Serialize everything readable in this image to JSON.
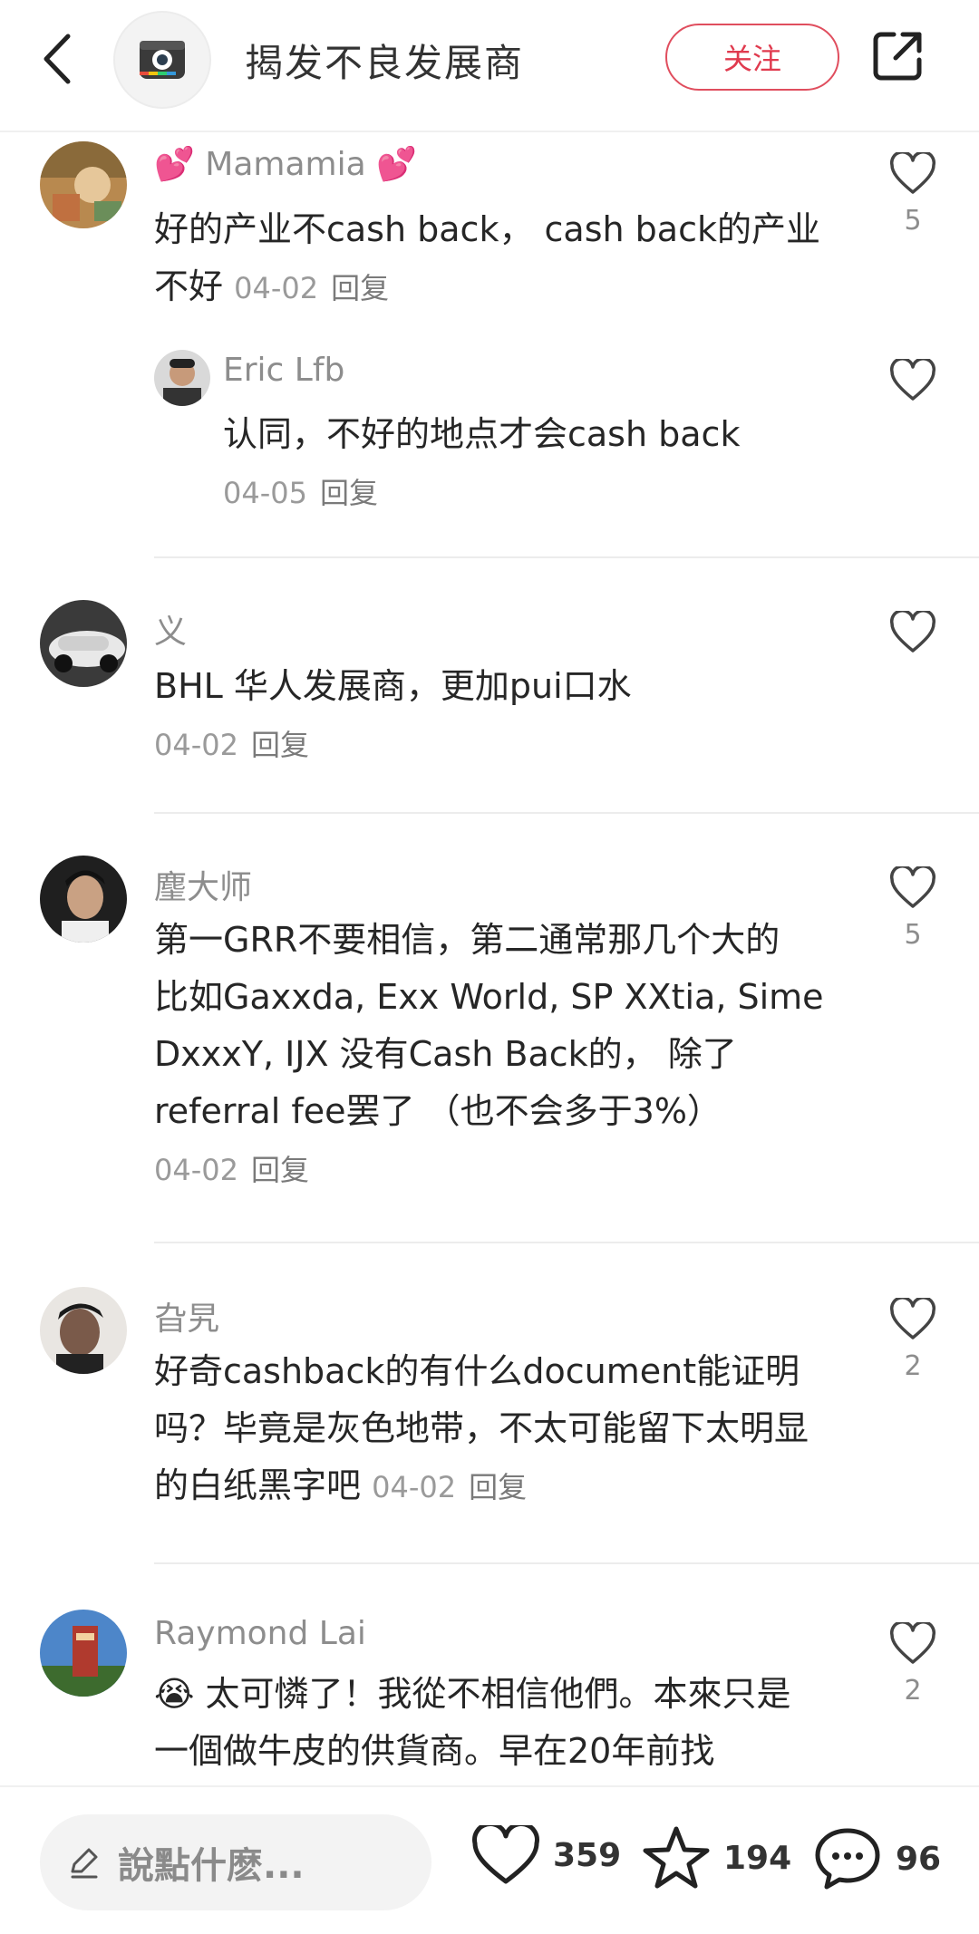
{
  "header": {
    "title": "揭发不良发展商",
    "follow_label": "关注"
  },
  "comments": [
    {
      "username_prefix": "💕",
      "username": "Mamamia",
      "username_suffix": "💕",
      "text": "好的产业不cash back， cash back的产业不好",
      "date": "04-02",
      "reply": "回复",
      "likes": "5"
    },
    {
      "username": "Eric Lfb",
      "text": "认同，不好的地点才会cash back",
      "date": "04-05",
      "reply": "回复",
      "likes": ""
    },
    {
      "username": "义",
      "text": "BHL 华人发展商，更加pui口水",
      "date": "04-02",
      "reply": "回复",
      "likes": ""
    },
    {
      "username": "麈大师",
      "text": "第一GRR不要相信，第二通常那几个大的 比如Gaxxda, Exx World, SP XXtia, Sime DxxxY, IJX 没有Cash Back的， 除了referral fee罢了 （也不会多于3%）",
      "date": "04-02",
      "reply": "回复",
      "likes": "5"
    },
    {
      "username": "旮旯",
      "text": "好奇cashback的有什么document能证明吗？毕竟是灰色地带，不太可能留下太明显的白纸黑字吧",
      "date": "04-02",
      "reply": "回复",
      "likes": "2"
    },
    {
      "username": "Raymond Lai",
      "text": "😭 太可憐了！我從不相信他們。本來只是一個做牛皮的供貨商。早在20年前找",
      "likes": "2"
    }
  ],
  "bottom": {
    "input_placeholder": "說點什麽...",
    "likes": "359",
    "favorites": "194",
    "comments": "96"
  },
  "colors": {
    "accent": "#e03a4e",
    "muted": "#8d8d8d"
  }
}
